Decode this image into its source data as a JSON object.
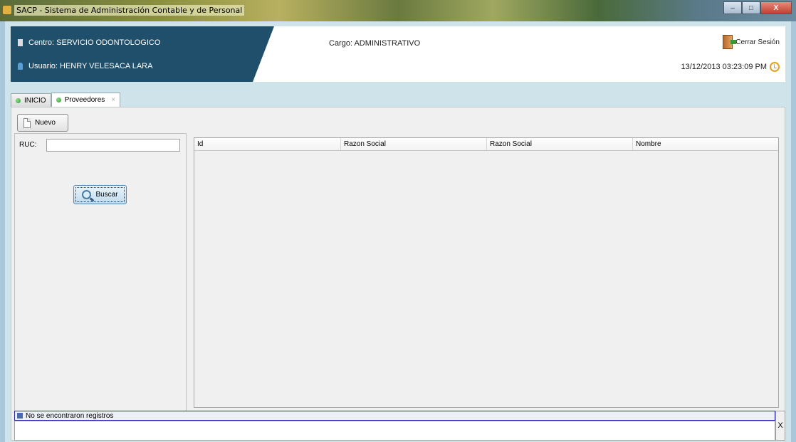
{
  "window": {
    "title": "SACP - Sistema de Administración Contable y de Personal",
    "buttons": [
      "–",
      "□",
      "X"
    ]
  },
  "header": {
    "centro": "Centro: SERVICIO ODONTOLOGICO",
    "usuario": "Usuario: HENRY VELESACA LARA",
    "cargo": "Cargo:  ADMINISTRATIVO",
    "logout_label": "Cerrar Sesión",
    "datetime": "13/12/2013 03:23:09 PM",
    "accent_color": "#1f4f6a"
  },
  "tabs": [
    {
      "label": "INICIO",
      "active": false
    },
    {
      "label": "Proveedores",
      "active": true,
      "close": "×"
    }
  ],
  "toolbar": {
    "nuevo_label": "Nuevo"
  },
  "search": {
    "ruc_label": "RUC:",
    "ruc_value": "",
    "buscar_label": "Buscar"
  },
  "table": {
    "columns": [
      "Id",
      "Razon Social",
      "Razon Social",
      "Nombre"
    ],
    "rows": []
  },
  "status": {
    "message": "No se encontraron registros",
    "close_label": "X"
  }
}
